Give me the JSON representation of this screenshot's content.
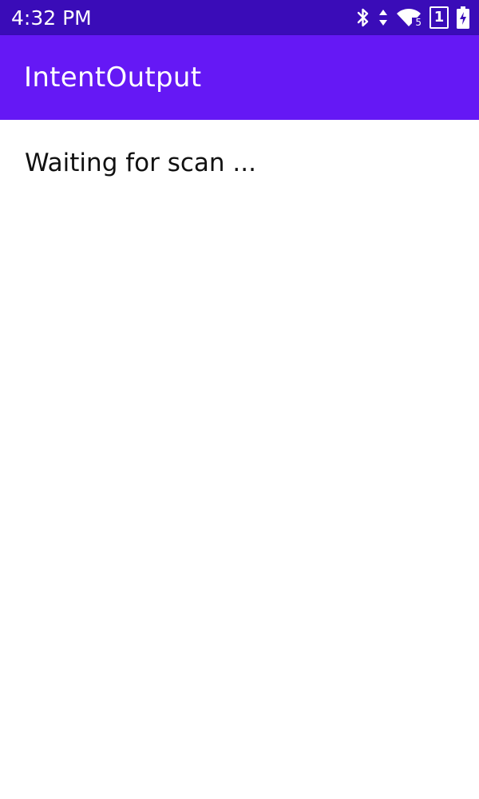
{
  "status_bar": {
    "time": "4:32 PM",
    "icons": [
      "bluetooth-icon",
      "data-arrows-icon",
      "wifi-icon",
      "sim-icon",
      "battery-charging-icon"
    ],
    "wifi_badge": "5",
    "sim_label": "1"
  },
  "app_bar": {
    "title": "IntentOutput",
    "background": "#6518f5"
  },
  "content": {
    "scan_status": "Waiting for scan ..."
  },
  "colors": {
    "status_bar": "#3a0cb8",
    "app_bar": "#6518f5",
    "text": "#111111"
  }
}
